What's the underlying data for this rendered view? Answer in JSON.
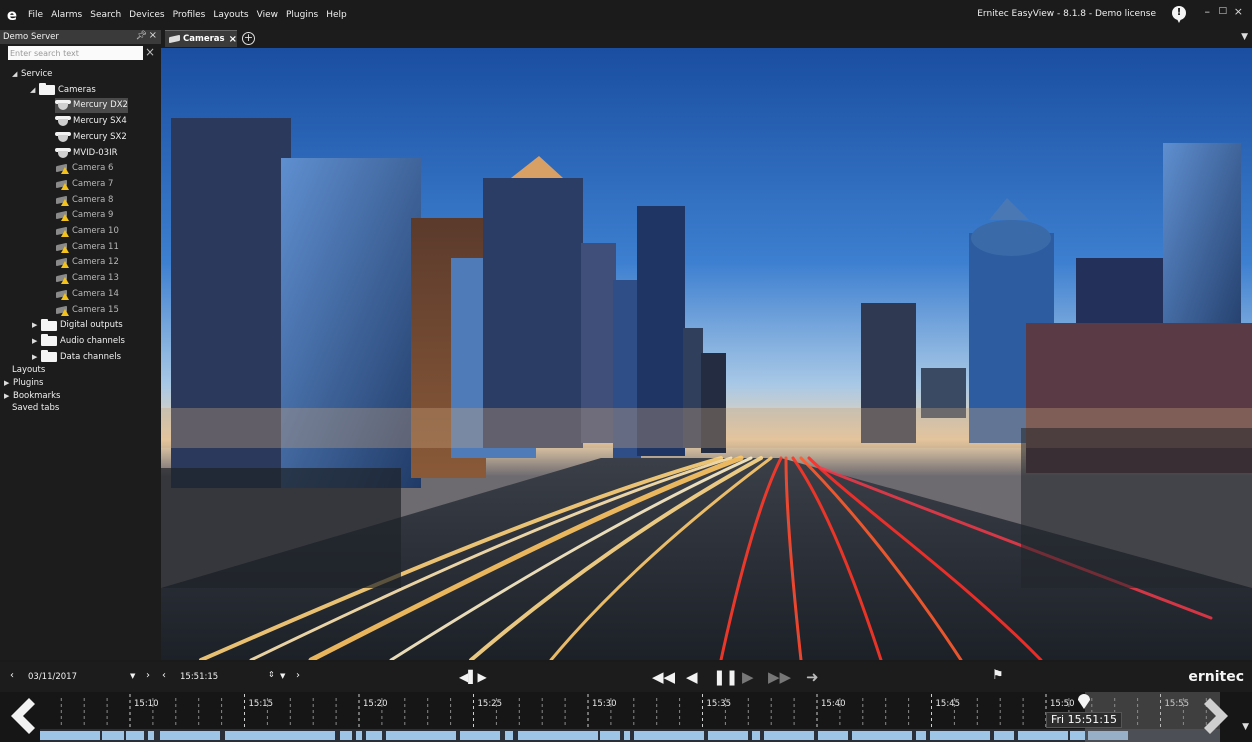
{
  "app": {
    "title": "Ernitec EasyView - 8.1.8 - Demo license",
    "logo": "e"
  },
  "menu": [
    "File",
    "Alarms",
    "Search",
    "Devices",
    "Profiles",
    "Layouts",
    "View",
    "Plugins",
    "Help"
  ],
  "window_controls": {
    "minimize": "–",
    "maximize": "□",
    "close": "×"
  },
  "left_panel": {
    "title": "Demo Server",
    "search_placeholder": "Enter search text",
    "tree": {
      "service": "Service",
      "cameras": "Cameras",
      "camera_items": [
        {
          "label": "Mercury DX2",
          "state": "online",
          "selected": true
        },
        {
          "label": "Mercury SX4",
          "state": "online"
        },
        {
          "label": "Mercury SX2",
          "state": "online"
        },
        {
          "label": "MVID-03IR",
          "state": "online"
        },
        {
          "label": "Camera 6",
          "state": "warning"
        },
        {
          "label": "Camera 7",
          "state": "warning"
        },
        {
          "label": "Camera 8",
          "state": "warning"
        },
        {
          "label": "Camera 9",
          "state": "warning"
        },
        {
          "label": "Camera 10",
          "state": "warning"
        },
        {
          "label": "Camera 11",
          "state": "warning"
        },
        {
          "label": "Camera 12",
          "state": "warning"
        },
        {
          "label": "Camera 13",
          "state": "warning"
        },
        {
          "label": "Camera 14",
          "state": "warning"
        },
        {
          "label": "Camera 15",
          "state": "warning"
        }
      ],
      "subfolders": [
        "Digital outputs",
        "Audio channels",
        "Data channels"
      ],
      "root_items": [
        "Layouts",
        "Plugins",
        "Bookmarks",
        "Saved tabs"
      ]
    }
  },
  "tabs": [
    {
      "label": "Cameras",
      "active": true
    }
  ],
  "playback": {
    "date": "03/11/2017",
    "time": "15:51:15",
    "brand": "ernitec"
  },
  "timeline": {
    "labels": [
      "15:10",
      "15:15",
      "15:20",
      "15:25",
      "15:30",
      "15:35",
      "15:40",
      "15:45",
      "15:50",
      "15:55"
    ],
    "cursor_tooltip": "Fri 15:51:15"
  },
  "colors": {
    "accent_warning": "#f3c21b",
    "background": "#1a1a1a",
    "recording_strip": "#9ec4e6"
  }
}
